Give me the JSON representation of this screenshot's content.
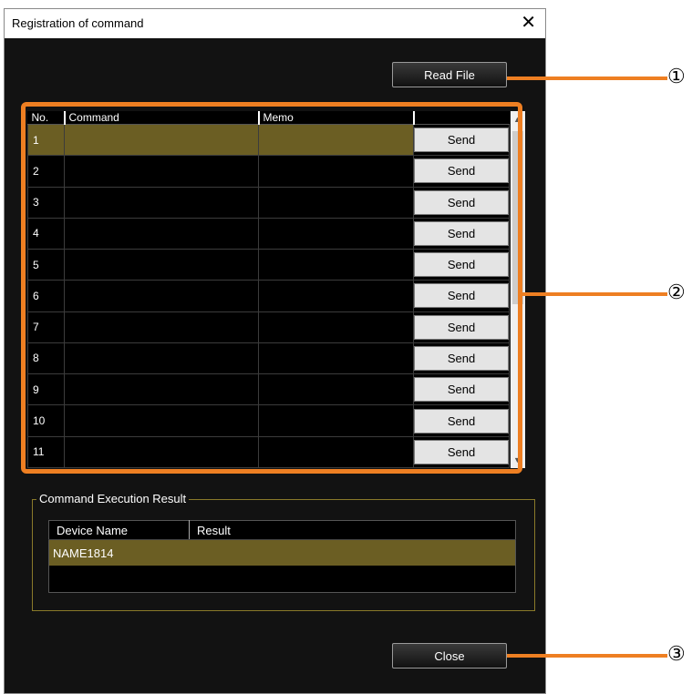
{
  "window": {
    "title": "Registration of command",
    "close_glyph": "✕"
  },
  "toolbar": {
    "read_file_label": "Read File"
  },
  "command_table": {
    "headers": [
      "No.",
      "Command",
      "Memo",
      ""
    ],
    "rows": [
      {
        "no": "1",
        "command": "",
        "memo": "",
        "action": "Send"
      },
      {
        "no": "2",
        "command": "",
        "memo": "",
        "action": "Send"
      },
      {
        "no": "3",
        "command": "",
        "memo": "",
        "action": "Send"
      },
      {
        "no": "4",
        "command": "",
        "memo": "",
        "action": "Send"
      },
      {
        "no": "5",
        "command": "",
        "memo": "",
        "action": "Send"
      },
      {
        "no": "6",
        "command": "",
        "memo": "",
        "action": "Send"
      },
      {
        "no": "7",
        "command": "",
        "memo": "",
        "action": "Send"
      },
      {
        "no": "8",
        "command": "",
        "memo": "",
        "action": "Send"
      },
      {
        "no": "9",
        "command": "",
        "memo": "",
        "action": "Send"
      },
      {
        "no": "10",
        "command": "",
        "memo": "",
        "action": "Send"
      },
      {
        "no": "11",
        "command": "",
        "memo": "",
        "action": "Send"
      }
    ],
    "selected_row": "1"
  },
  "result_group": {
    "label": "Command Execution Result",
    "headers": [
      "Device Name",
      "Result"
    ],
    "rows": [
      {
        "device": "NAME1814",
        "result": ""
      }
    ]
  },
  "footer": {
    "close_label": "Close"
  },
  "callouts": [
    "①",
    "②",
    "③"
  ],
  "colors": {
    "accent_orange": "#ee7f22",
    "selection": "#6b5e23",
    "background": "#121212"
  }
}
